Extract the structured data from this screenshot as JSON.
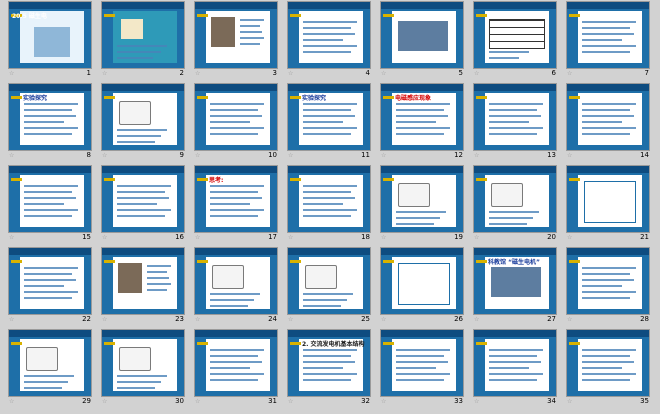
{
  "slides": [
    {
      "number": "1",
      "title": "20.5 磁生电"
    },
    {
      "number": "2",
      "title": ""
    },
    {
      "number": "3",
      "title": ""
    },
    {
      "number": "4",
      "title": ""
    },
    {
      "number": "5",
      "title": ""
    },
    {
      "number": "6",
      "title": ""
    },
    {
      "number": "7",
      "title": ""
    },
    {
      "number": "8",
      "title": "实验探究"
    },
    {
      "number": "9",
      "title": ""
    },
    {
      "number": "10",
      "title": ""
    },
    {
      "number": "11",
      "title": "实验探究"
    },
    {
      "number": "12",
      "title": "电磁感应现象"
    },
    {
      "number": "13",
      "title": ""
    },
    {
      "number": "14",
      "title": ""
    },
    {
      "number": "15",
      "title": ""
    },
    {
      "number": "16",
      "title": ""
    },
    {
      "number": "17",
      "title": "思考:"
    },
    {
      "number": "18",
      "title": ""
    },
    {
      "number": "19",
      "title": ""
    },
    {
      "number": "20",
      "title": ""
    },
    {
      "number": "21",
      "title": ""
    },
    {
      "number": "22",
      "title": ""
    },
    {
      "number": "23",
      "title": ""
    },
    {
      "number": "24",
      "title": ""
    },
    {
      "number": "25",
      "title": ""
    },
    {
      "number": "26",
      "title": ""
    },
    {
      "number": "27",
      "title": "科教馆 “磁生电机”"
    },
    {
      "number": "28",
      "title": ""
    },
    {
      "number": "29",
      "title": ""
    },
    {
      "number": "30",
      "title": ""
    },
    {
      "number": "31",
      "title": ""
    },
    {
      "number": "32",
      "title": "2. 交流发电机基本结构"
    },
    {
      "number": "33",
      "title": ""
    },
    {
      "number": "34",
      "title": ""
    },
    {
      "number": "35",
      "title": ""
    }
  ],
  "colors": {
    "slide_bg": "#1e6fa8",
    "header": "#0e4c80",
    "accent": "#ffe100",
    "red": "#d40000",
    "sorter_bg": "#d2d2d2"
  }
}
